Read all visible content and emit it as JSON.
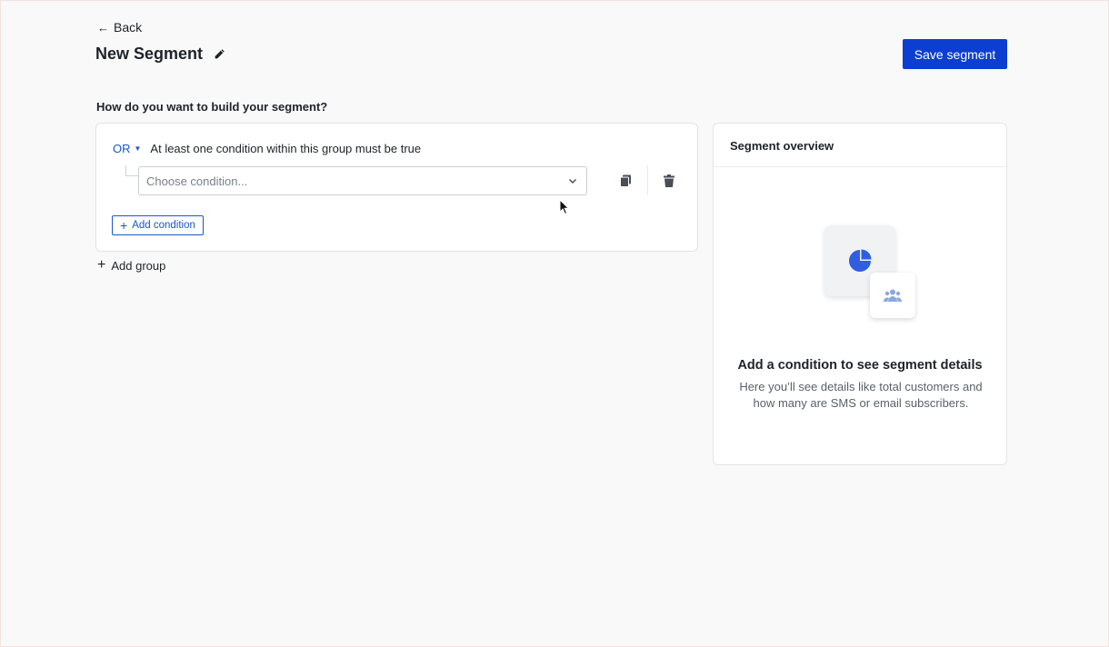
{
  "nav": {
    "back_label": "Back"
  },
  "header": {
    "title": "New Segment",
    "save_label": "Save segment"
  },
  "builder": {
    "question": "How do you want to build your segment?",
    "group": {
      "operator": "OR",
      "description": "At least one condition within this group must be true",
      "condition_placeholder": "Choose condition...",
      "add_condition_label": "Add condition"
    },
    "add_group_label": "Add group"
  },
  "overview": {
    "title": "Segment overview",
    "empty_heading": "Add a condition to see segment details",
    "empty_body": "Here you’ll see details like total customers and how many are SMS or email subscribers."
  },
  "icons": {
    "back": "arrow-left-icon",
    "edit": "pencil-icon",
    "caret": "chevron-down-icon",
    "copy": "copy-icon",
    "delete": "trash-icon",
    "add": "plus-icon",
    "illustration_main": "pie-chart-icon",
    "illustration_secondary": "users-icon"
  },
  "colors": {
    "primary": "#0c3ed1",
    "link": "#1a55d0",
    "illustration_blue": "#2f5fe0",
    "illustration_light_blue": "#8ea8dc"
  }
}
